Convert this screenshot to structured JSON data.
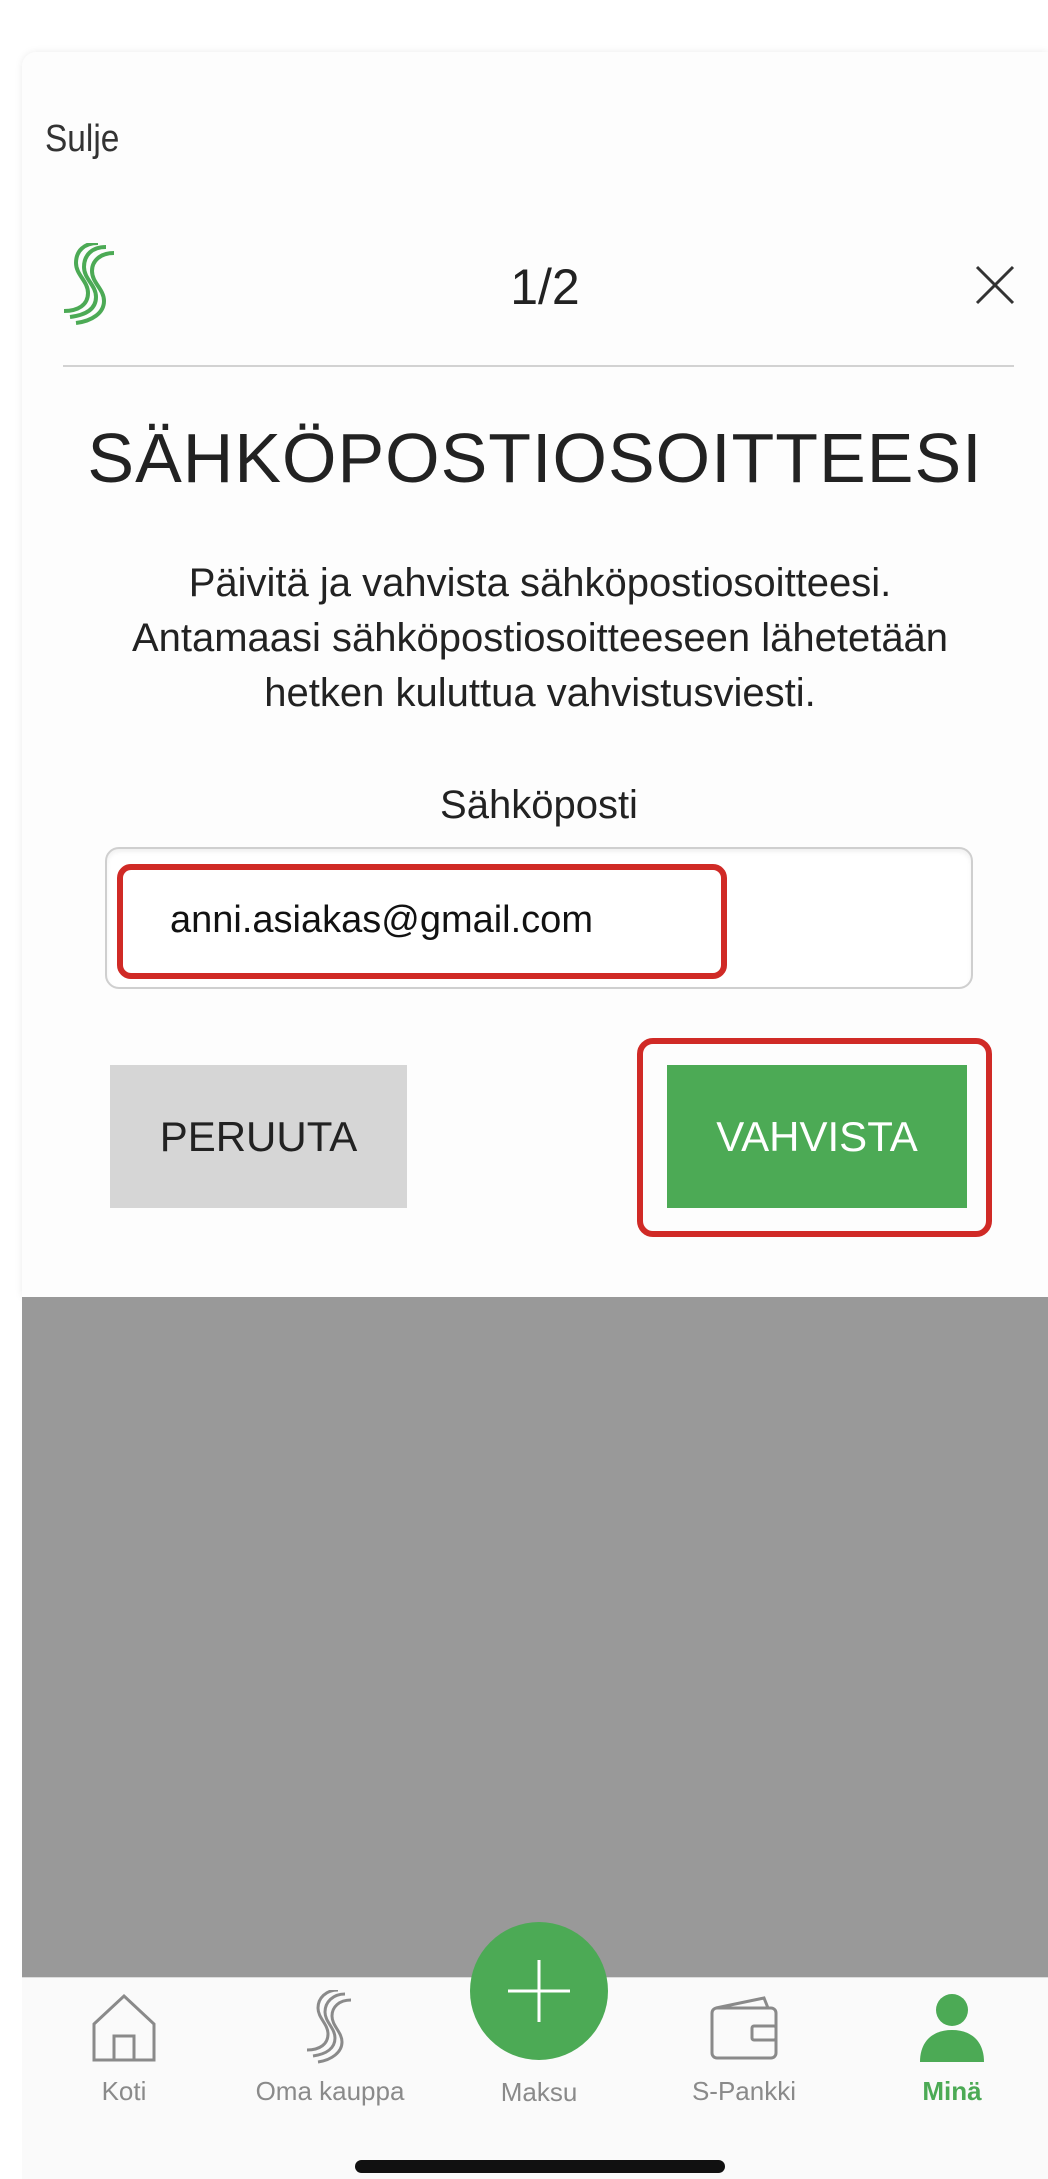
{
  "header": {
    "close_label": "Sulje",
    "step": "1/2",
    "logo_icon": "s-group-logo",
    "close_icon": "close-icon"
  },
  "dialog": {
    "title": "SÄHKÖPOSTIOSOITTEESI",
    "description": "Päivitä ja vahvista sähköpostiosoitteesi. Antamaasi sähköpostiosoitteeseen lähetetään hetken kuluttua vahvistusviesti.",
    "email_label": "Sähköposti",
    "email_value": "anni.asiakas@gmail.com",
    "cancel_label": "PERUUTA",
    "confirm_label": "VAHVISTA"
  },
  "tabbar": {
    "tabs": [
      {
        "label": "Koti",
        "icon": "home-icon"
      },
      {
        "label": "Oma kauppa",
        "icon": "s-logo-icon"
      },
      {
        "label": "Maksu",
        "icon": "plus-icon"
      },
      {
        "label": "S-Pankki",
        "icon": "wallet-icon"
      },
      {
        "label": "Minä",
        "icon": "person-icon"
      }
    ],
    "active": "Minä"
  },
  "colors": {
    "accent_green": "#4caa55",
    "highlight_red": "#d02a26",
    "backdrop": "#999999"
  }
}
